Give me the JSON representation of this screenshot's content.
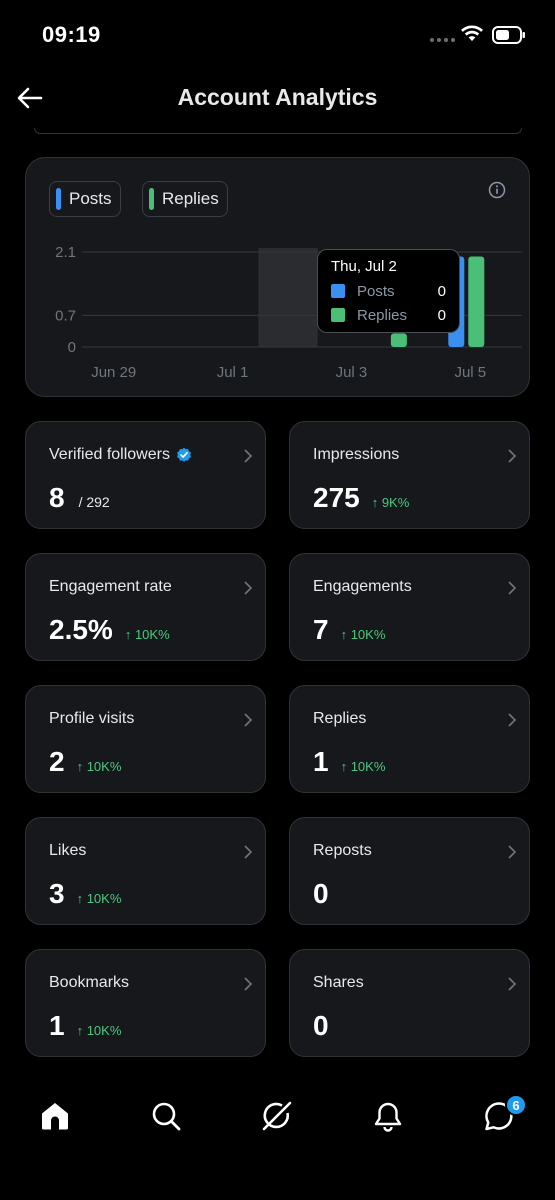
{
  "status_bar": {
    "time": "09:19"
  },
  "header": {
    "title": "Account Analytics"
  },
  "colors": {
    "posts": "#3b8ff0",
    "replies": "#4bbf78",
    "positive_change": "#4bc97d",
    "verified": "#1d9bf0"
  },
  "chart_data": {
    "type": "bar",
    "legend": [
      "Posts",
      "Replies"
    ],
    "x_tick_labels": [
      "Jun 29",
      "Jul 1",
      "Jul 3",
      "Jul 5"
    ],
    "y_tick_labels": [
      "2.1",
      "0.7",
      "0"
    ],
    "ylim": [
      0,
      2.1
    ],
    "categories": [
      "Jun 29",
      "Jun 30",
      "Jul 1",
      "Jul 2",
      "Jul 3",
      "Jul 4",
      "Jul 5"
    ],
    "series": [
      {
        "name": "Posts",
        "values": [
          0,
          0,
          0,
          0,
          0,
          0,
          2
        ]
      },
      {
        "name": "Replies",
        "values": [
          0,
          0,
          0,
          0,
          0,
          0.3,
          2
        ]
      }
    ],
    "tooltip": {
      "date": "Thu, Jul 2",
      "rows": [
        {
          "label": "Posts",
          "value": "0"
        },
        {
          "label": "Replies",
          "value": "0"
        }
      ]
    },
    "highlighted_category": "Jul 2"
  },
  "metrics": [
    {
      "label": "Verified followers",
      "value": "8",
      "sub": "/ 292",
      "change": "",
      "verified_badge": true
    },
    {
      "label": "Impressions",
      "value": "275",
      "sub": "",
      "change": "↑ 9K%"
    },
    {
      "label": "Engagement rate",
      "value": "2.5%",
      "sub": "",
      "change": "↑ 10K%"
    },
    {
      "label": "Engagements",
      "value": "7",
      "sub": "",
      "change": "↑ 10K%"
    },
    {
      "label": "Profile visits",
      "value": "2",
      "sub": "",
      "change": "↑ 10K%"
    },
    {
      "label": "Replies",
      "value": "1",
      "sub": "",
      "change": "↑ 10K%"
    },
    {
      "label": "Likes",
      "value": "3",
      "sub": "",
      "change": "↑ 10K%"
    },
    {
      "label": "Reposts",
      "value": "0",
      "sub": "",
      "change": ""
    },
    {
      "label": "Bookmarks",
      "value": "1",
      "sub": "",
      "change": "↑ 10K%"
    },
    {
      "label": "Shares",
      "value": "0",
      "sub": "",
      "change": ""
    }
  ],
  "bottom_nav": {
    "items": [
      "home-icon",
      "search-icon",
      "grok-icon",
      "notifications-icon",
      "messages-icon"
    ],
    "messages_badge": "6"
  }
}
